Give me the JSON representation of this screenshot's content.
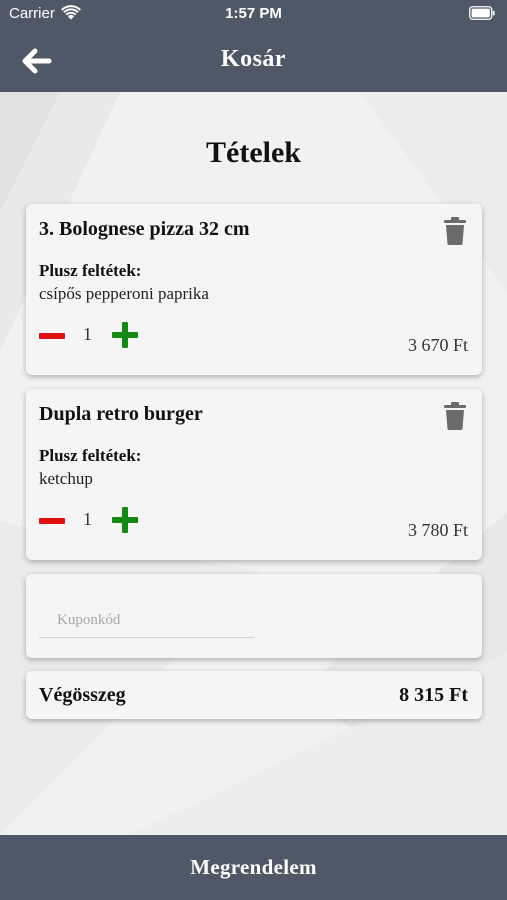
{
  "status_bar": {
    "carrier": "Carrier",
    "time": "1:57 PM"
  },
  "nav": {
    "title": "Kosár",
    "back_icon": "arrow-left-icon"
  },
  "section_title": "Tételek",
  "items": [
    {
      "name": "3. Bolognese pizza 32 cm",
      "extras_label": "Plusz feltétek:",
      "extras": "csípős pepperoni paprika",
      "quantity": "1",
      "price": "3 670 Ft"
    },
    {
      "name": "Dupla retro burger",
      "extras_label": "Plusz feltétek:",
      "extras": "ketchup",
      "quantity": "1",
      "price": "3 780 Ft"
    }
  ],
  "coupon": {
    "placeholder": "Kuponkód",
    "value": ""
  },
  "total": {
    "label": "Végösszeg",
    "value": "8 315 Ft"
  },
  "order_button": "Megrendelem",
  "colors": {
    "header_bg": "#4f5867",
    "minus": "#e01010",
    "plus": "#138a13",
    "trash": "#6b6b6b"
  }
}
